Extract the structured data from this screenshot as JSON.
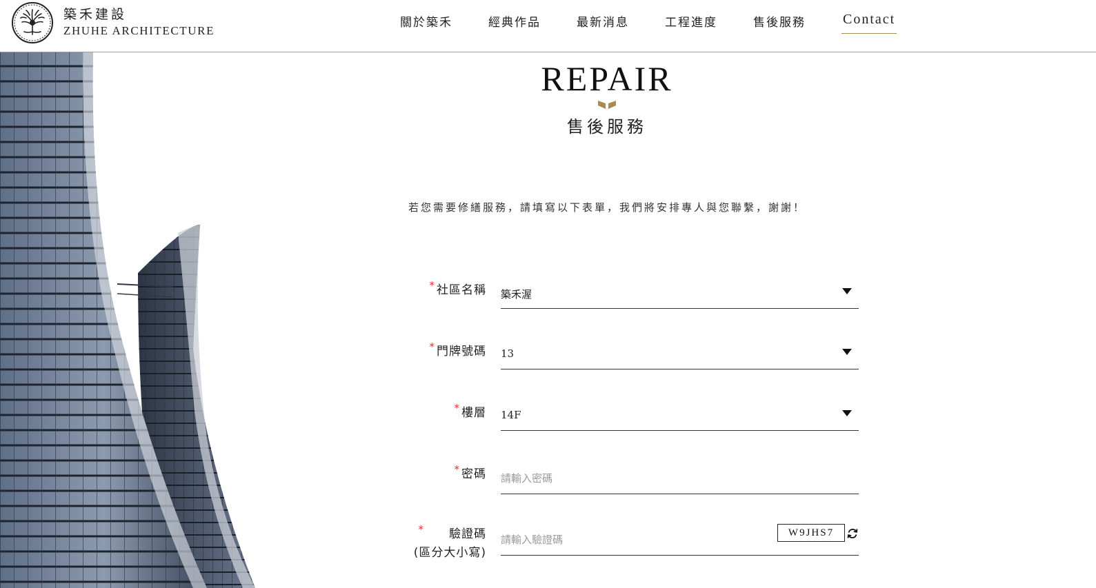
{
  "header": {
    "logo_cn": "築禾建設",
    "logo_en": "ZHUHE ARCHITECTURE",
    "nav": [
      {
        "label": "關於築禾"
      },
      {
        "label": "經典作品"
      },
      {
        "label": "最新消息"
      },
      {
        "label": "工程進度"
      },
      {
        "label": "售後服務"
      },
      {
        "label": "Contact"
      }
    ],
    "active_nav": "Contact"
  },
  "hero": {
    "title_en": "REPAIR",
    "title_cn": "售後服務",
    "intro": "若您需要修繕服務，請填寫以下表單，我們將安排專人與您聯繫，謝謝！"
  },
  "form": {
    "required_mark": "*",
    "community": {
      "label": "社區名稱",
      "value": "築禾渥"
    },
    "door_number": {
      "label": "門牌號碼",
      "value": "13"
    },
    "floor": {
      "label": "樓層",
      "value": "14F"
    },
    "password": {
      "label": "密碼",
      "placeholder": "請輸入密碼"
    },
    "captcha": {
      "label": "驗證碼",
      "label_note": "(區分大小寫)",
      "placeholder": "請輸入驗證碼",
      "code": "W9JHS7"
    }
  },
  "colors": {
    "accent_gold": "#a98b52",
    "required_red": "#e0312b",
    "text": "#222222"
  },
  "icons": {
    "logo": "tree-seal-icon",
    "ornament": "gold-chevron-icon",
    "dropdown": "caret-down-icon",
    "refresh": "refresh-icon"
  }
}
